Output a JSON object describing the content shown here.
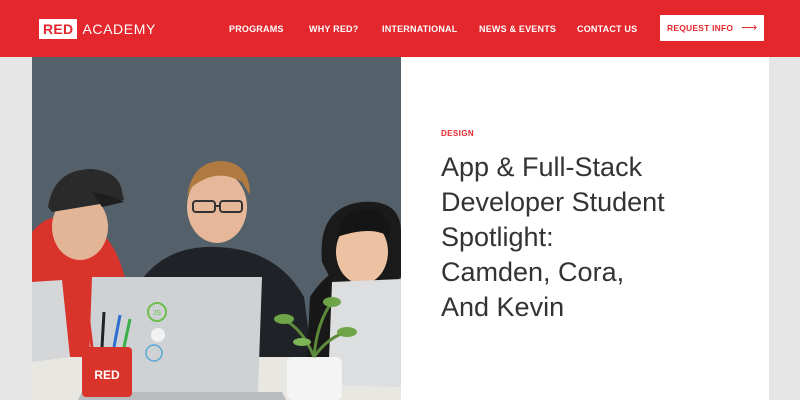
{
  "header": {
    "logo_box": "RED",
    "logo_text": "ACADEMY",
    "nav": [
      {
        "label": "PROGRAMS"
      },
      {
        "label": "WHY RED?"
      },
      {
        "label": "INTERNATIONAL"
      },
      {
        "label": "NEWS & EVENTS"
      },
      {
        "label": "CONTACT US"
      }
    ],
    "cta_label": "REQUEST INFO",
    "cta_icon": "arrow-right-icon"
  },
  "hero": {
    "category": "DESIGN",
    "title_lines": [
      "App & Full-Stack",
      "Developer Student",
      "Spotlight:",
      "Camden, Cora,",
      "And Kevin"
    ],
    "photo": {
      "mug_text": "RED",
      "sticker_text": "JS"
    }
  },
  "colors": {
    "brand_red": "#e3272d",
    "page_bg": "#e6e6e6",
    "headline": "#333333"
  }
}
